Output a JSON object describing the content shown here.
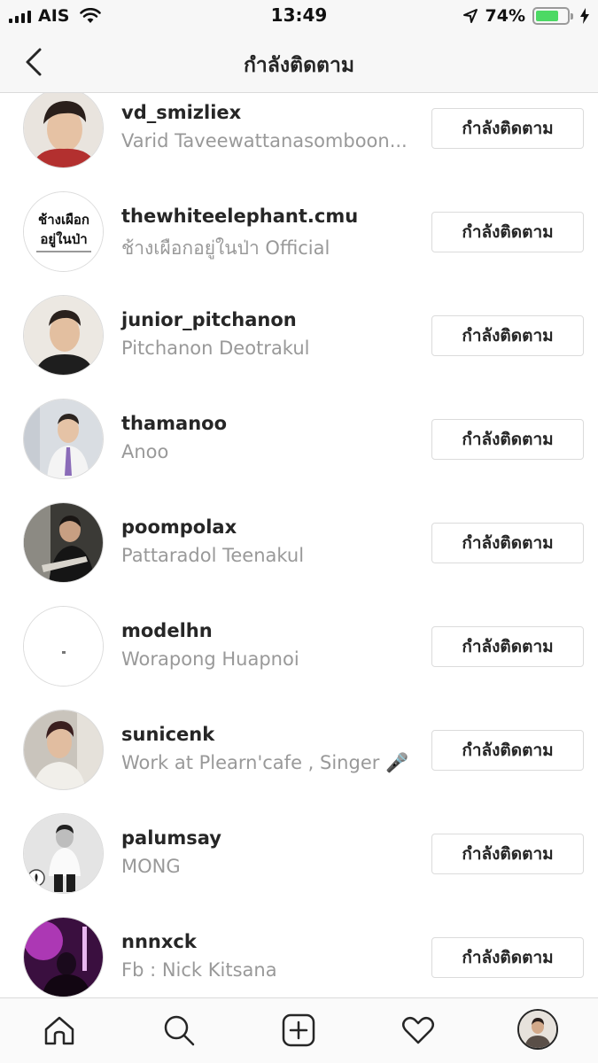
{
  "status_bar": {
    "carrier": "AIS",
    "time": "13:49",
    "battery_percent": "74%",
    "battery_level": 0.74,
    "icons": [
      "signal-icon",
      "wifi-icon",
      "location-arrow-icon",
      "battery-icon",
      "charging-bolt-icon"
    ]
  },
  "header": {
    "title": "กำลังติดตาม",
    "back_icon": "chevron-left-icon"
  },
  "following": [
    {
      "username": "vd_smizliex",
      "full_name": "Varid Taveewattanasomboon...",
      "button": "กำลังติดตาม"
    },
    {
      "username": "thewhiteelephant.cmu",
      "full_name": "ช้างเผือกอยู่ในป่า Official",
      "button": "กำลังติดตาม",
      "avatar_text": [
        "ช้างเผือก",
        "อยู่ในป่า"
      ]
    },
    {
      "username": "junior_pitchanon",
      "full_name": "Pitchanon Deotrakul",
      "button": "กำลังติดตาม"
    },
    {
      "username": "thamanoo",
      "full_name": "Anoo",
      "button": "กำลังติดตาม"
    },
    {
      "username": "poompolax",
      "full_name": "Pattaradol Teenakul",
      "button": "กำลังติดตาม"
    },
    {
      "username": "modelhn",
      "full_name": "Worapong Huapnoi",
      "button": "กำลังติดตาม"
    },
    {
      "username": "sunicenk",
      "full_name": "Work at Plearn'cafe , Singer 🎤",
      "button": "กำลังติดตาม"
    },
    {
      "username": "palumsay",
      "full_name": "MONG",
      "button": "กำลังติดตาม"
    },
    {
      "username": "nnnxck",
      "full_name": "Fb : Nick Kitsana",
      "button": "กำลังติดตาม"
    }
  ],
  "tab_bar": {
    "tabs": [
      "home-icon",
      "search-icon",
      "add-post-icon",
      "heart-icon",
      "profile-avatar"
    ]
  },
  "colors": {
    "text_primary": "#262626",
    "text_secondary": "#999999",
    "border": "#dbdbdb",
    "battery_green": "#4cd964",
    "bar_background": "#f7f7f7"
  }
}
